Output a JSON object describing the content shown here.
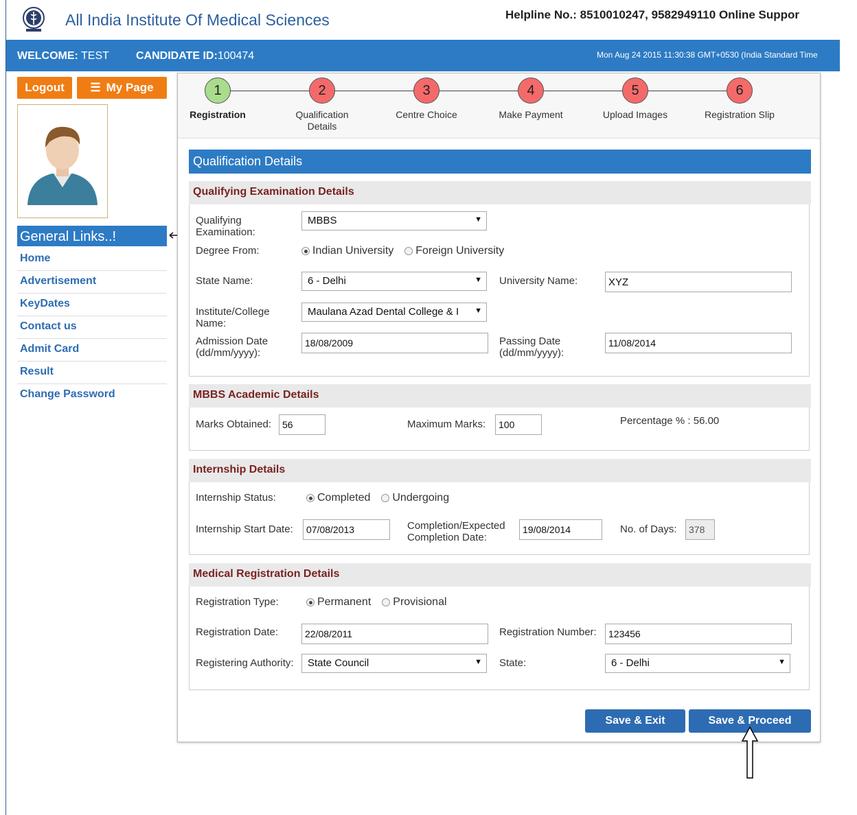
{
  "header": {
    "site_title": "All India Institute Of Medical Sciences",
    "helpline": "Helpline No.: 8510010247, 9582949110 Online Suppor",
    "welcome_label": "WELCOME:",
    "welcome_name": "TEST",
    "candidate_label": "CANDIDATE ID:",
    "candidate_id": "100474",
    "datetime": "Mon Aug 24 2015 11:30:38 GMT+0530 (India Standard Time"
  },
  "sidebar": {
    "logout": "Logout",
    "mypage": "My Page",
    "general_links": "General Links..!",
    "links": [
      "Home",
      "Advertisement",
      "KeyDates",
      "Contact us",
      "Admit Card",
      "Result",
      "Change Password"
    ]
  },
  "wizard": {
    "steps": [
      {
        "num": "1",
        "label": "Registration",
        "status": "done"
      },
      {
        "num": "2",
        "label": "Qualification Details",
        "status": "todo"
      },
      {
        "num": "3",
        "label": "Centre Choice",
        "status": "todo"
      },
      {
        "num": "4",
        "label": "Make Payment",
        "status": "todo"
      },
      {
        "num": "5",
        "label": "Upload Images",
        "status": "todo"
      },
      {
        "num": "6",
        "label": "Registration Slip",
        "status": "todo"
      }
    ]
  },
  "form": {
    "title": "Qualification Details",
    "qualifying": {
      "heading": "Qualifying Examination Details",
      "exam_label": "Qualifying Examination:",
      "exam_value": "MBBS",
      "degree_label": "Degree From:",
      "degree_opt1": "Indian University",
      "degree_opt2": "Foreign University",
      "state_label": "State Name:",
      "state_value": "6 - Delhi",
      "university_label": "University Name:",
      "university_value": "XYZ",
      "institute_label": "Institute/College Name:",
      "institute_value": "Maulana Azad Dental College & I",
      "admission_label": "Admission Date (dd/mm/yyyy):",
      "admission_value": "18/08/2009",
      "passing_label": "Passing Date (dd/mm/yyyy):",
      "passing_value": "11/08/2014"
    },
    "academic": {
      "heading": "MBBS Academic Details",
      "marks_label": "Marks Obtained:",
      "marks_value": "56",
      "max_label": "Maximum Marks:",
      "max_value": "100",
      "percentage_text": "Percentage % : 56.00"
    },
    "internship": {
      "heading": "Internship Details",
      "status_label": "Internship Status:",
      "status_opt1": "Completed",
      "status_opt2": "Undergoing",
      "start_label": "Internship Start Date:",
      "start_value": "07/08/2013",
      "completion_label": "Completion/Expected Completion Date:",
      "completion_value": "19/08/2014",
      "days_label": "No. of Days:",
      "days_value": "378"
    },
    "medical": {
      "heading": "Medical Registration Details",
      "type_label": "Registration Type:",
      "type_opt1": "Permanent",
      "type_opt2": "Provisional",
      "date_label": "Registration Date:",
      "date_value": "22/08/2011",
      "number_label": "Registration Number:",
      "number_value": "123456",
      "authority_label": "Registering Authority:",
      "authority_value": "State Council",
      "state_label": "State:",
      "state_value": "6 - Delhi"
    },
    "save_exit": "Save & Exit",
    "save_proceed": "Save & Proceed"
  },
  "colors": {
    "primary_blue": "#2d7bc4",
    "orange": "#f07d14",
    "step_done": "#a9dd8d",
    "step_todo": "#f46a6a",
    "section_heading": "#7a2222"
  }
}
